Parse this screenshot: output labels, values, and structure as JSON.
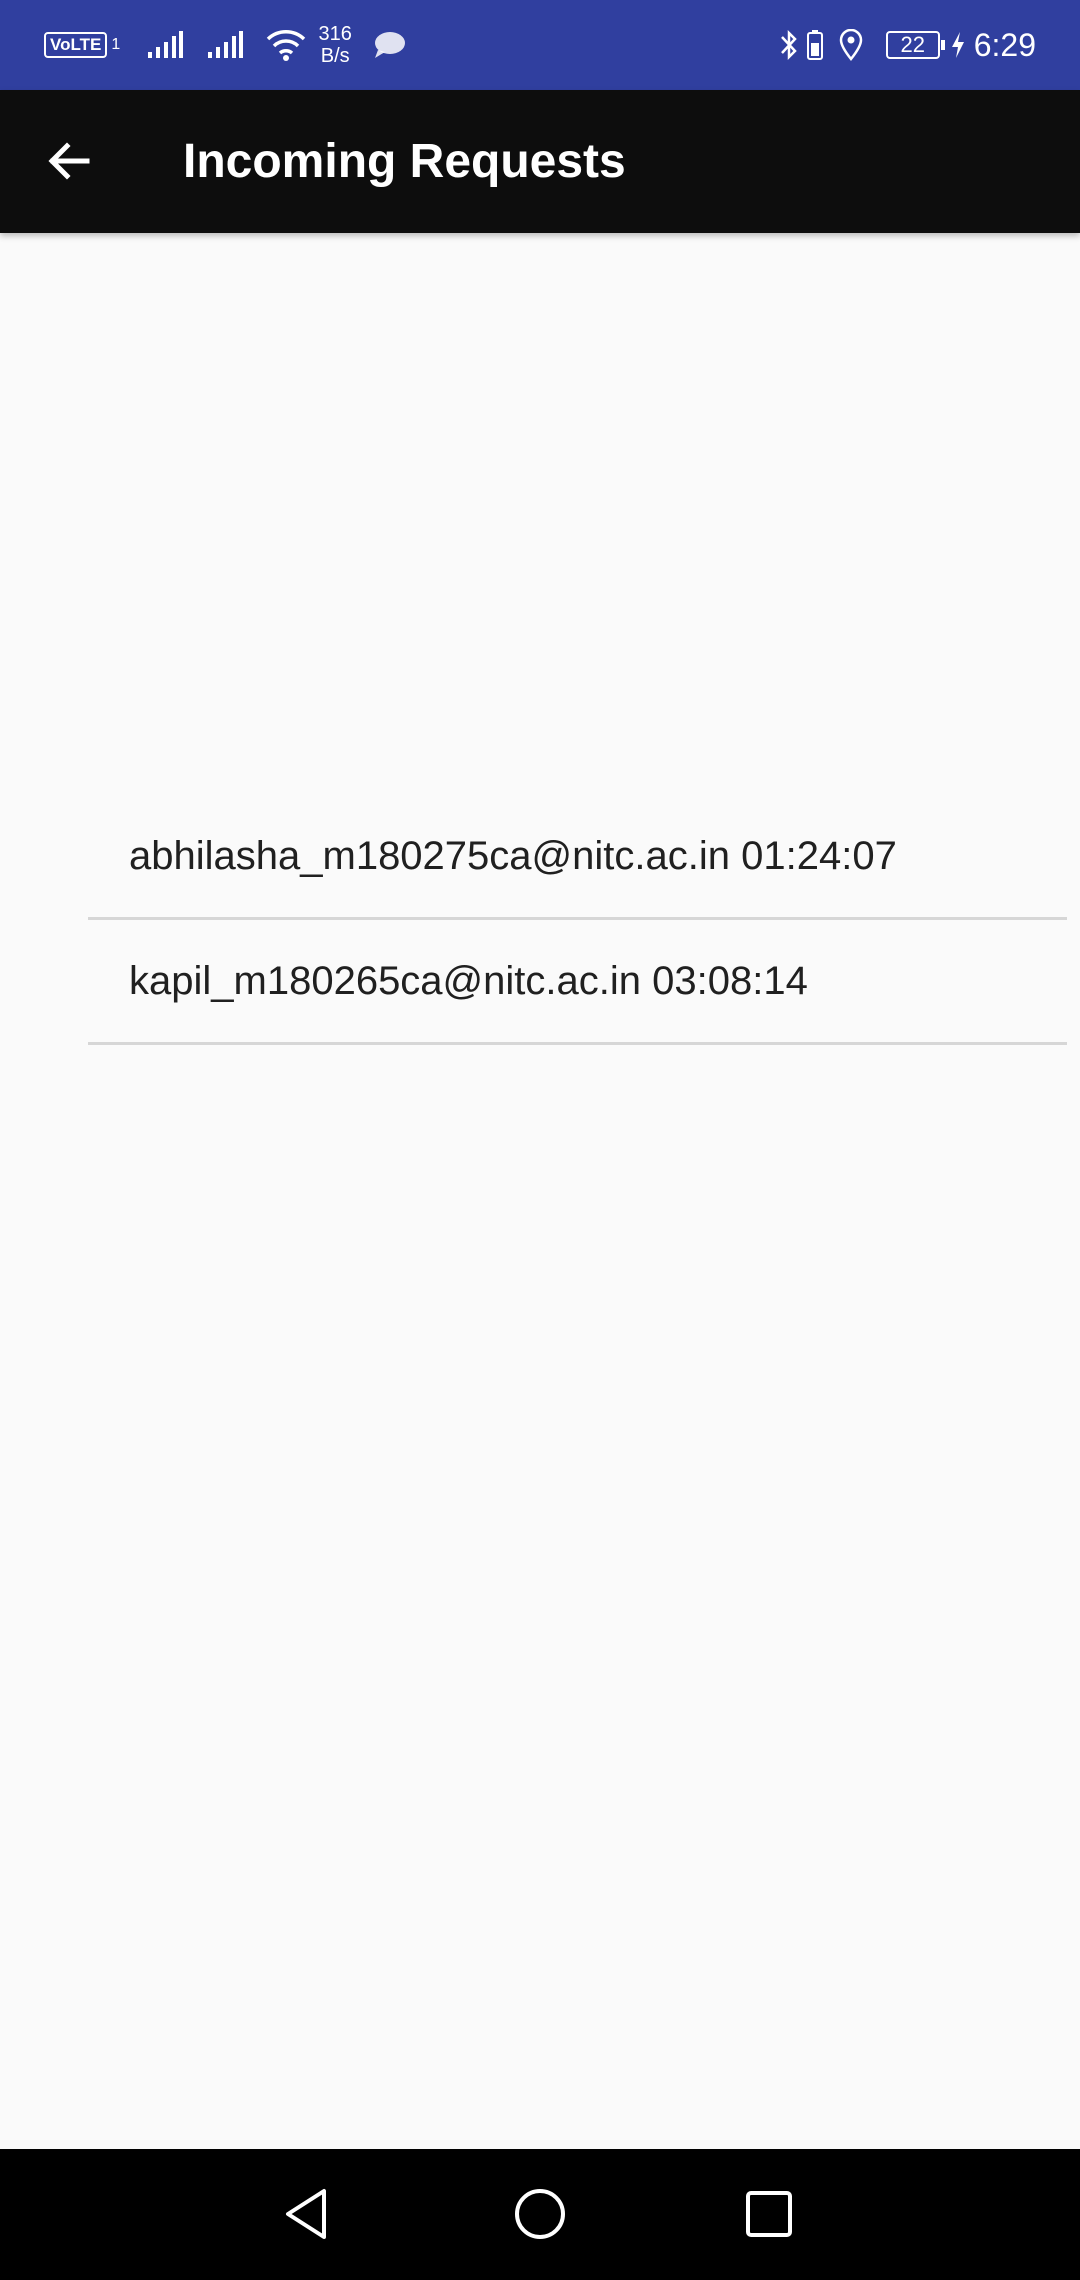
{
  "status_bar": {
    "volte": "VoLTE",
    "volte_sub": "1",
    "speed_value": "316",
    "speed_unit": "B/s",
    "battery": "22",
    "time": "6:29",
    "icons": [
      "signal-icon",
      "signal-icon",
      "wifi-icon",
      "chat-icon",
      "bluetooth-icon",
      "battery-icon",
      "location-icon",
      "charging-icon"
    ]
  },
  "app_bar": {
    "title": "Incoming Requests",
    "back_icon": "arrow-back-icon"
  },
  "requests": [
    {
      "label": "abhilasha_m180275ca@nitc.ac.in  01:24:07"
    },
    {
      "label": "kapil_m180265ca@nitc.ac.in  03:08:14"
    }
  ],
  "nav_bar": {
    "icons": [
      "nav-back-icon",
      "nav-home-icon",
      "nav-recent-icon"
    ]
  },
  "colors": {
    "status_bar": "#303f9f",
    "app_bar": "#0d0d0d",
    "background": "#fafafa",
    "divider": "#d6d6d6",
    "nav_bar": "#000000"
  }
}
